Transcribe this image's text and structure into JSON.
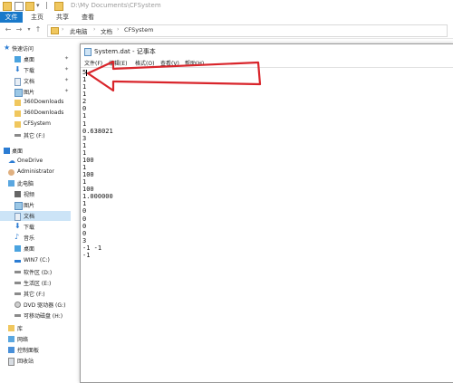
{
  "explorer": {
    "title": "D:\\My Documents\\CFSystem",
    "tabs": [
      "文件",
      "主页",
      "共享",
      "查看"
    ],
    "breadcrumb": [
      "此电脑",
      "文档",
      "CFSystem"
    ]
  },
  "sidebar": {
    "items": [
      {
        "label": "快速访问"
      },
      {
        "label": "桌面"
      },
      {
        "label": "下载"
      },
      {
        "label": "文档"
      },
      {
        "label": "图片"
      },
      {
        "label": "360Downloads"
      },
      {
        "label": "360Downloads"
      },
      {
        "label": "CFSystem"
      },
      {
        "label": "其它 (F:)"
      },
      {
        "label": "桌面"
      },
      {
        "label": "OneDrive"
      },
      {
        "label": "Administrator"
      },
      {
        "label": "此电脑"
      },
      {
        "label": "视频"
      },
      {
        "label": "图片"
      },
      {
        "label": "文档"
      },
      {
        "label": "下载"
      },
      {
        "label": "音乐"
      },
      {
        "label": "桌面"
      },
      {
        "label": "WIN7 (C:)"
      },
      {
        "label": "软件区 (D:)"
      },
      {
        "label": "生活区 (E:)"
      },
      {
        "label": "其它 (F:)"
      },
      {
        "label": "DVD 驱动器 (G:)"
      },
      {
        "label": "可移动磁盘 (H:)"
      },
      {
        "label": "库"
      },
      {
        "label": "网络"
      },
      {
        "label": "控制面板"
      },
      {
        "label": "回收站"
      }
    ]
  },
  "notepad": {
    "title": "System.dat - 记事本",
    "menu": [
      "文件(F)",
      "编辑(E)",
      "格式(O)",
      "查看(V)",
      "帮助(H)"
    ],
    "lines": [
      "5",
      "1",
      "1",
      "1",
      "2",
      "0",
      "1",
      "1",
      "0.638021",
      "3",
      "1",
      "1",
      "100",
      "1",
      "100",
      "1",
      "100",
      "1.000000",
      "1",
      "0",
      "0",
      "0",
      "0",
      "3",
      "-1 -1",
      "-1"
    ]
  },
  "colors": {
    "file_tab": "#1979ca",
    "selection": "#cce4f7",
    "arrow": "#d9252b"
  }
}
